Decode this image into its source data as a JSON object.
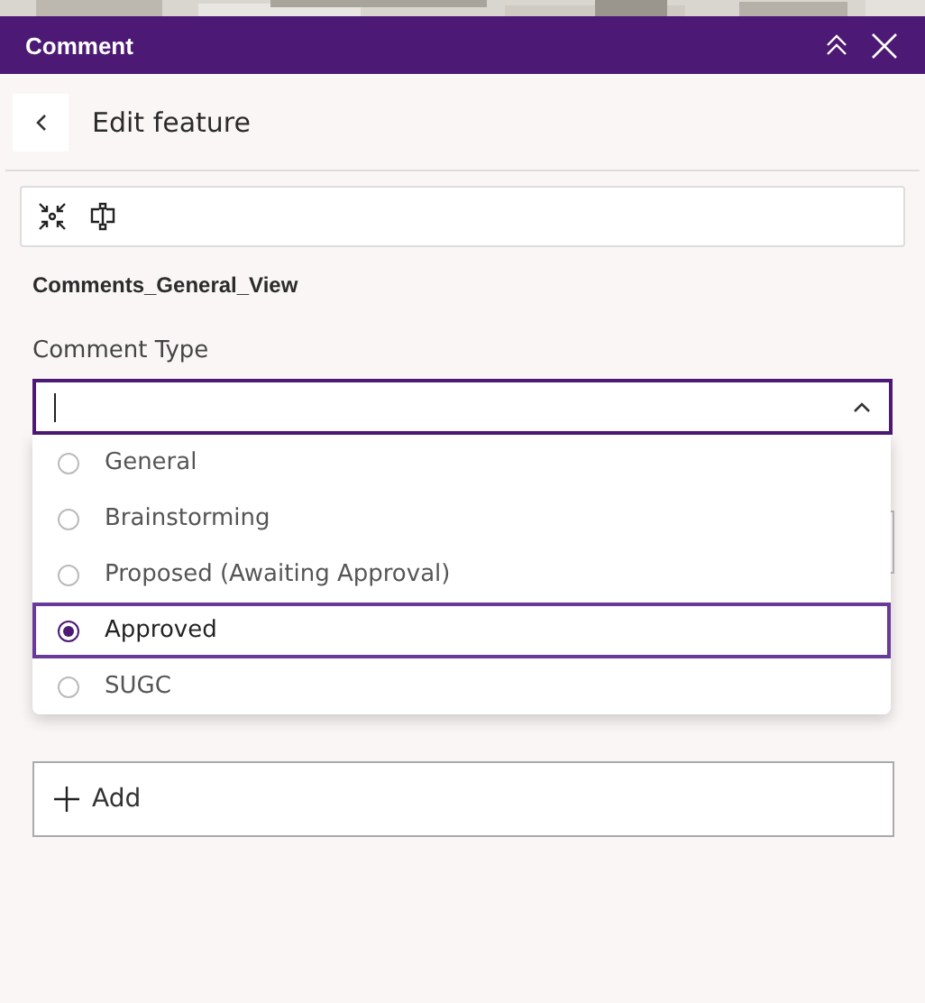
{
  "panel": {
    "title": "Comment"
  },
  "nav": {
    "title": "Edit feature"
  },
  "layer_name": "Comments_General_View",
  "field": {
    "label": "Comment Type",
    "expanded": true,
    "options": [
      {
        "label": "General",
        "selected": false
      },
      {
        "label": "Brainstorming",
        "selected": false
      },
      {
        "label": "Proposed (Awaiting Approval)",
        "selected": false
      },
      {
        "label": "Approved",
        "selected": true
      },
      {
        "label": "SUGC",
        "selected": false
      }
    ]
  },
  "attachments": {
    "add_button": "Add"
  }
}
